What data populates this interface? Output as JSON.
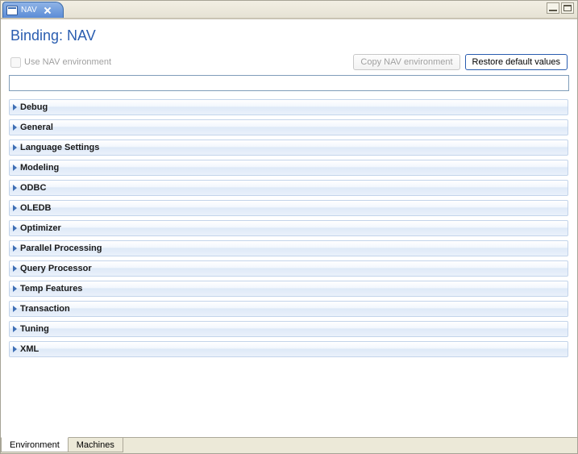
{
  "tab": {
    "icon": "form-icon",
    "title": "NAV",
    "close_icon": "close-icon"
  },
  "window_controls": {
    "minimize_icon": "minimize-icon",
    "maximize_icon": "maximize-icon"
  },
  "heading": "Binding: NAV",
  "toolbar": {
    "checkbox_label": "Use NAV environment",
    "checkbox_checked": false,
    "checkbox_enabled": false,
    "copy_label": "Copy NAV environment",
    "copy_enabled": false,
    "restore_label": "Restore default values",
    "restore_enabled": true
  },
  "filter": {
    "value": "",
    "placeholder": ""
  },
  "sections": [
    {
      "label": "Debug"
    },
    {
      "label": "General"
    },
    {
      "label": "Language Settings"
    },
    {
      "label": "Modeling"
    },
    {
      "label": "ODBC"
    },
    {
      "label": "OLEDB"
    },
    {
      "label": "Optimizer"
    },
    {
      "label": "Parallel Processing"
    },
    {
      "label": "Query Processor"
    },
    {
      "label": "Temp Features"
    },
    {
      "label": "Transaction"
    },
    {
      "label": "Tuning"
    },
    {
      "label": "XML"
    }
  ],
  "bottom_tabs": {
    "items": [
      {
        "label": "Environment",
        "active": true
      },
      {
        "label": "Machines",
        "active": false
      }
    ]
  },
  "colors": {
    "accent": "#2a5db0",
    "section_border": "#c3d4ea",
    "frame_bg": "#ece9d8"
  }
}
